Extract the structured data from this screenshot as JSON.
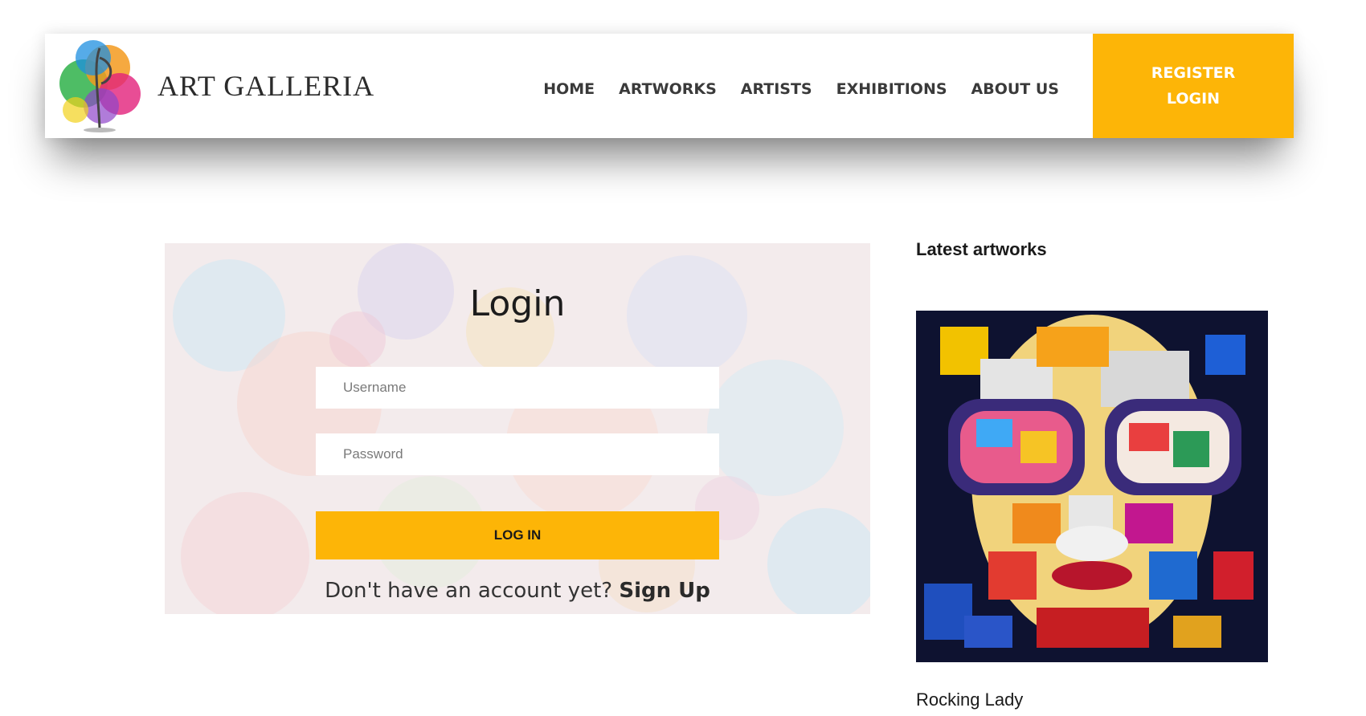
{
  "brand": {
    "name": "ART GALLERIA",
    "accent_color": "#fdb507"
  },
  "nav": {
    "items": [
      "HOME",
      "ARTWORKS",
      "ARTISTS",
      "EXHIBITIONS",
      "ABOUT US"
    ],
    "register_label": "REGISTER",
    "login_label": "LOGIN"
  },
  "login_form": {
    "title": "Login",
    "username_placeholder": "Username",
    "password_placeholder": "Password",
    "submit_label": "LOG IN",
    "signup_prompt": "Don't have an account yet?",
    "signup_link": "Sign Up"
  },
  "sidebar": {
    "heading": "Latest artworks",
    "artwork_title": "Rocking Lady"
  }
}
